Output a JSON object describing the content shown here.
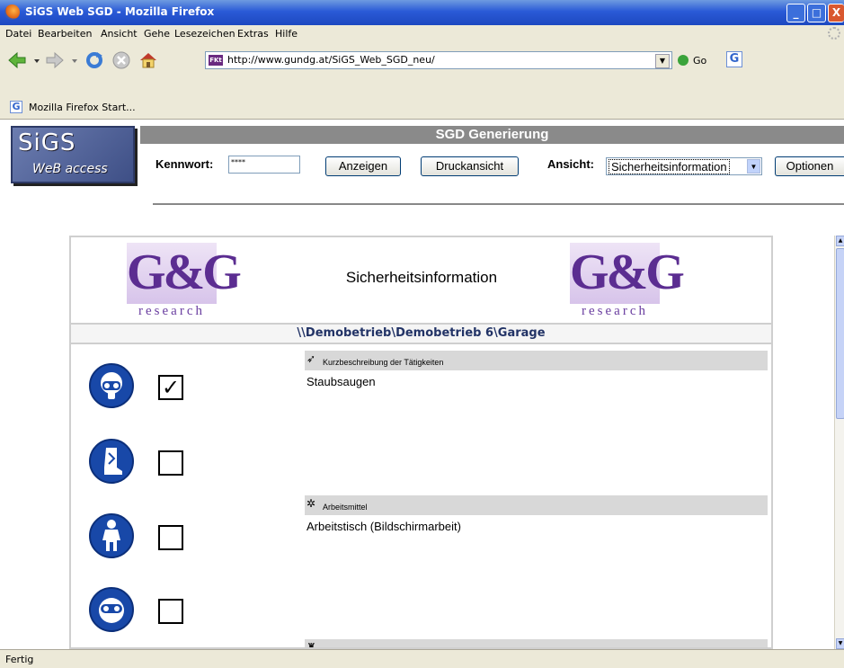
{
  "window": {
    "title": "SiGS Web SGD - Mozilla Firefox",
    "min": "_",
    "max": "□",
    "close": "X"
  },
  "menu": [
    "Datei",
    "Bearbeiten",
    "Ansicht",
    "Gehe",
    "Lesezeichen",
    "Extras",
    "Hilfe"
  ],
  "nav": {
    "url": "http://www.gundg.at/SiGS_Web_SGD_neu/",
    "url_favicon": "FKt",
    "go_label": "Go",
    "g": "G"
  },
  "bookmarks": {
    "item": "Mozilla Firefox Start..."
  },
  "app": {
    "logo_line1": "SiGS",
    "logo_line2": "WeB access",
    "header": "SGD Generierung",
    "password_label": "Kennwort:",
    "password_value": "****",
    "show_button": "Anzeigen",
    "print_button": "Druckansicht",
    "view_label": "Ansicht:",
    "view_selected": "Sicherheitsinformation",
    "options_button": "Optionen"
  },
  "panel": {
    "logo_mark": "G&G",
    "logo_sub": "research",
    "title": "Sicherheitsinformation",
    "path": "\\\\Demobetrieb\\Demobetrieb 6\\Garage",
    "pictograms": [
      {
        "icon": "respirator-icon",
        "checked": true,
        "mark": "✓"
      },
      {
        "icon": "protective-boots-icon",
        "checked": false,
        "mark": ""
      },
      {
        "icon": "protective-clothing-icon",
        "checked": false,
        "mark": ""
      },
      {
        "icon": "safety-goggles-icon",
        "checked": false,
        "mark": ""
      }
    ],
    "sections": [
      {
        "title": "Kurzbeschreibung der Tätigkeiten",
        "text": "Staubsaugen"
      },
      {
        "title": "Arbeitsmittel",
        "text": "Arbeitstisch (Bildschirmarbeit)"
      },
      {
        "title": "",
        "text": ""
      }
    ]
  },
  "status": "Fertig"
}
